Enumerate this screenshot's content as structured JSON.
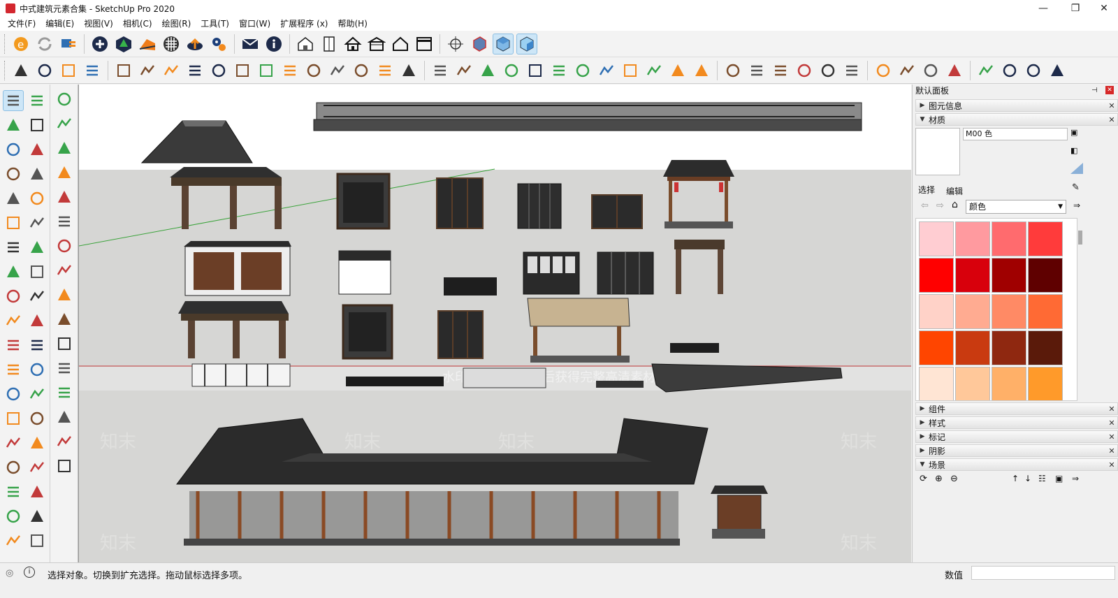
{
  "window": {
    "title": "中式建筑元素合集 - SketchUp Pro 2020",
    "minimize": "—",
    "maximize": "❐",
    "close": "✕"
  },
  "menu": [
    "文件(F)",
    "编辑(E)",
    "视图(V)",
    "相机(C)",
    "绘图(R)",
    "工具(T)",
    "窗口(W)",
    "扩展程序 (x)",
    "帮助(H)"
  ],
  "viewport": {
    "sky_color": "#ffffff",
    "ground_color": "#d5d5d3",
    "watermark_text": "知末",
    "overlay_text": "水印保护区 · 购买后获得完整高清素材文件"
  },
  "tray": {
    "title": "默认面板",
    "pin": "📌",
    "close": "✕",
    "panels_top": [
      {
        "label": "图元信息",
        "expanded": false
      },
      {
        "label": "材质",
        "expanded": true
      }
    ],
    "material": {
      "name": "M00 色",
      "tab_select": "选择",
      "tab_edit": "编辑",
      "collection": "颜色",
      "swatches": [
        "#ffcdd2",
        "#ff9a9f",
        "#ff6b6e",
        "#ff3b3b",
        "#ff0000",
        "#d8000c",
        "#a00000",
        "#5f0000",
        "#ffd2c8",
        "#ffab91",
        "#ff8a65",
        "#ff6a34",
        "#ff4500",
        "#c93a10",
        "#8f2810",
        "#5a1a0a",
        "#ffe5d4",
        "#ffc89a",
        "#ffb068",
        "#ff9a2a"
      ]
    },
    "panels_bottom": [
      {
        "label": "组件",
        "expanded": false
      },
      {
        "label": "样式",
        "expanded": false
      },
      {
        "label": "标记",
        "expanded": false
      },
      {
        "label": "阴影",
        "expanded": false
      },
      {
        "label": "场景",
        "expanded": true
      }
    ]
  },
  "status": {
    "message": "选择对象。切换到扩充选择。拖动鼠标选择多项。",
    "value_label": "数值",
    "value": ""
  },
  "toolbar1_icons": [
    "extension-warehouse-icon",
    "reload-icon",
    "send-to-layout-icon",
    "add-location-icon",
    "3d-warehouse-tree-icon",
    "sandbox-icon",
    "texture-checker-icon",
    "upload-cloud-icon",
    "settings-gears-icon",
    "email-icon",
    "info-icon",
    "house-iso-icon",
    "door-icon",
    "home-icon",
    "roof-box-icon",
    "house-outline-icon",
    "storefront-icon",
    "position-camera-icon",
    "section-box-icon",
    "iso-view-icon",
    "iso-view-blue-icon"
  ],
  "toolbar2_icons": [
    "stair-tool-icon",
    "column-icon",
    "ramp-icon",
    "bar-steps-icon",
    "truss-icon",
    "beam-icon",
    "branch-icon",
    "multi-branch-icon",
    "arch-icon",
    "rotate-arrow-icon",
    "tree-branch-icon",
    "slab-icon",
    "curve-icon",
    "flat-plane-icon",
    "stack-plane-icon",
    "cube-cut-icon",
    "layer-stack-icon",
    "arch-curve-icon",
    "dots-row-icon",
    "wave-icon",
    "spiral-icon",
    "pen-cut-icon",
    "comb-icon",
    "pillars-icon",
    "triangle-split-icon",
    "dot-grid-icon",
    "book-icon",
    "compass-icon",
    "brush-icon",
    "model-badge-icon",
    "photo-badge-icon",
    "grid-table-icon",
    "checkbox-icon",
    "env-glyph-icon",
    "model-glyph-icon",
    "cloud-link-icon",
    "cloud-gear-icon",
    "cloud-check-icon",
    "cloud-sync-icon",
    "fit-frame-icon",
    "network-icon",
    "refresh-check-icon",
    "chrome-style-icon"
  ],
  "lefttools_icons": [
    "select-arrow-icon",
    "eraser-outline-icon",
    "paint-bucket-icon",
    "eraser-icon",
    "pencil-icon",
    "freehand-icon",
    "rectangle-icon",
    "rotated-rect-icon",
    "circle-icon",
    "polygon-icon",
    "arc-icon",
    "arc2-icon",
    "pie-icon",
    "arc3-icon",
    "move-icon",
    "push-pull-icon",
    "rotate-icon",
    "follow-me-icon",
    "scale-icon",
    "offset-icon",
    "tape-measure-icon",
    "dimension-icon",
    "protractor-icon",
    "text-icon",
    "axes-icon",
    "3d-text-icon",
    "orbit-icon",
    "pan-hand-icon",
    "zoom-icon",
    "zoom-window-icon",
    "zoom-extents-icon",
    "previous-view-icon",
    "position-camera-icon",
    "look-around-icon",
    "walk-icon",
    "section-plane-icon",
    "ruby-icon",
    "ruby2-icon"
  ]
}
